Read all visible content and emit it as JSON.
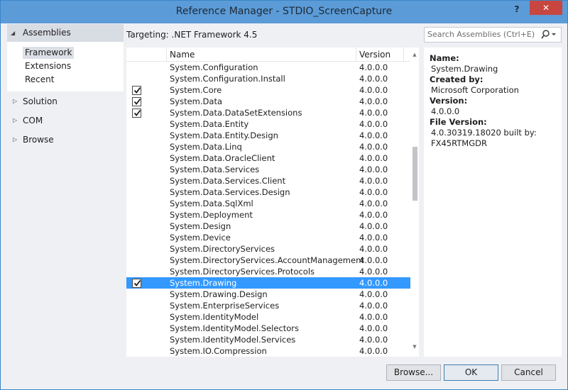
{
  "window": {
    "title": "Reference Manager - STDIO_ScreenCapture",
    "help": "?",
    "close": "✕"
  },
  "nav": {
    "assemblies": "Assemblies",
    "sub_items": [
      {
        "label": "Framework",
        "selected": true
      },
      {
        "label": "Extensions",
        "selected": false
      },
      {
        "label": "Recent",
        "selected": false
      }
    ],
    "solution": "Solution",
    "com": "COM",
    "browse": "Browse"
  },
  "targeting": "Targeting: .NET Framework 4.5",
  "search": {
    "placeholder": "Search Assemblies (Ctrl+E)",
    "icon": "search-icon"
  },
  "table": {
    "columns": {
      "name": "Name",
      "version": "Version"
    },
    "rows": [
      {
        "name": "System.Configuration",
        "version": "4.0.0.0",
        "checked": false,
        "selected": false
      },
      {
        "name": "System.Configuration.Install",
        "version": "4.0.0.0",
        "checked": false,
        "selected": false
      },
      {
        "name": "System.Core",
        "version": "4.0.0.0",
        "checked": true,
        "selected": false
      },
      {
        "name": "System.Data",
        "version": "4.0.0.0",
        "checked": true,
        "selected": false
      },
      {
        "name": "System.Data.DataSetExtensions",
        "version": "4.0.0.0",
        "checked": true,
        "selected": false
      },
      {
        "name": "System.Data.Entity",
        "version": "4.0.0.0",
        "checked": false,
        "selected": false
      },
      {
        "name": "System.Data.Entity.Design",
        "version": "4.0.0.0",
        "checked": false,
        "selected": false
      },
      {
        "name": "System.Data.Linq",
        "version": "4.0.0.0",
        "checked": false,
        "selected": false
      },
      {
        "name": "System.Data.OracleClient",
        "version": "4.0.0.0",
        "checked": false,
        "selected": false
      },
      {
        "name": "System.Data.Services",
        "version": "4.0.0.0",
        "checked": false,
        "selected": false
      },
      {
        "name": "System.Data.Services.Client",
        "version": "4.0.0.0",
        "checked": false,
        "selected": false
      },
      {
        "name": "System.Data.Services.Design",
        "version": "4.0.0.0",
        "checked": false,
        "selected": false
      },
      {
        "name": "System.Data.SqlXml",
        "version": "4.0.0.0",
        "checked": false,
        "selected": false
      },
      {
        "name": "System.Deployment",
        "version": "4.0.0.0",
        "checked": false,
        "selected": false
      },
      {
        "name": "System.Design",
        "version": "4.0.0.0",
        "checked": false,
        "selected": false
      },
      {
        "name": "System.Device",
        "version": "4.0.0.0",
        "checked": false,
        "selected": false
      },
      {
        "name": "System.DirectoryServices",
        "version": "4.0.0.0",
        "checked": false,
        "selected": false
      },
      {
        "name": "System.DirectoryServices.AccountManagement",
        "version": "4.0.0.0",
        "checked": false,
        "selected": false
      },
      {
        "name": "System.DirectoryServices.Protocols",
        "version": "4.0.0.0",
        "checked": false,
        "selected": false
      },
      {
        "name": "System.Drawing",
        "version": "4.0.0.0",
        "checked": true,
        "selected": true
      },
      {
        "name": "System.Drawing.Design",
        "version": "4.0.0.0",
        "checked": false,
        "selected": false
      },
      {
        "name": "System.EnterpriseServices",
        "version": "4.0.0.0",
        "checked": false,
        "selected": false
      },
      {
        "name": "System.IdentityModel",
        "version": "4.0.0.0",
        "checked": false,
        "selected": false
      },
      {
        "name": "System.IdentityModel.Selectors",
        "version": "4.0.0.0",
        "checked": false,
        "selected": false
      },
      {
        "name": "System.IdentityModel.Services",
        "version": "4.0.0.0",
        "checked": false,
        "selected": false
      },
      {
        "name": "System.IO.Compression",
        "version": "4.0.0.0",
        "checked": false,
        "selected": false
      }
    ]
  },
  "details": {
    "name_label": "Name:",
    "name_value": "System.Drawing",
    "created_label": "Created by:",
    "created_value": "Microsoft Corporation",
    "version_label": "Version:",
    "version_value": "4.0.0.0",
    "file_version_label": "File Version:",
    "file_version_line1": "4.0.30319.18020 built by:",
    "file_version_line2": "FX45RTMGDR"
  },
  "buttons": {
    "browse": "Browse...",
    "ok": "OK",
    "cancel": "Cancel"
  },
  "colors": {
    "accent": "#5b9bd7",
    "selection": "#3399ff",
    "close": "#c7463f"
  }
}
